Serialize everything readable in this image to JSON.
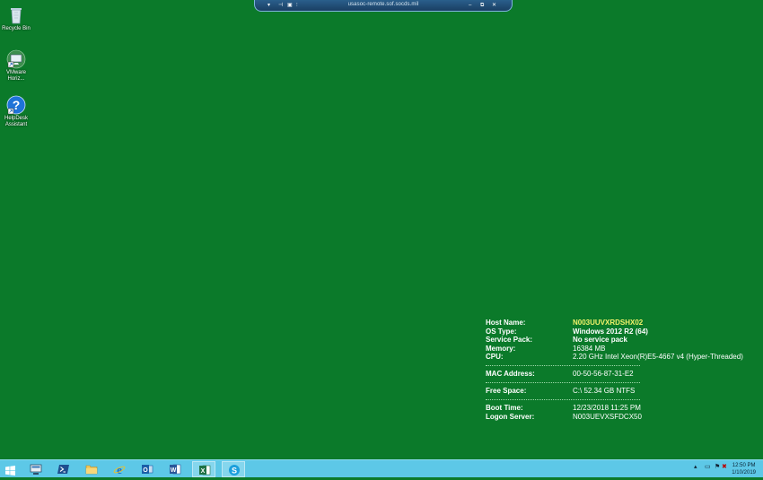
{
  "rdp_bar": {
    "title": "usasoc-remote.sof.socds.mil"
  },
  "desktop_icons": [
    {
      "label": "Recycle Bin",
      "icon": "recycle-bin-icon"
    },
    {
      "label": "VMware Horiz...",
      "icon": "vmware-horizon-icon"
    },
    {
      "label": "HelpDesk Assistant",
      "icon": "helpdesk-icon"
    }
  ],
  "bginfo": {
    "host_name_label": "Host Name:",
    "host_name": "N003UUVXRDSHX02",
    "os_type_label": "OS Type:",
    "os_type": "Windows 2012 R2 (64)",
    "service_pack_label": "Service Pack:",
    "service_pack": "No service pack",
    "memory_label": "Memory:",
    "memory": "16384 MB",
    "cpu_label": "CPU:",
    "cpu": "2.20 GHz Intel Xeon(R)E5-4667 v4 (Hyper-Threaded)",
    "mac_label": "MAC Address:",
    "mac": "00-50-56-87-31-E2",
    "free_space_label": "Free Space:",
    "free_space": "C:\\ 52.34 GB NTFS",
    "boot_time_label": "Boot Time:",
    "boot_time": "12/23/2018 11:25 PM",
    "logon_server_label": "Logon Server:",
    "logon_server": "N003UEVXSFDCX50"
  },
  "taskbar": {
    "apps": [
      {
        "name": "server-manager",
        "icon": "server-manager-icon"
      },
      {
        "name": "powershell",
        "icon": "powershell-icon"
      },
      {
        "name": "file-explorer",
        "icon": "folder-icon"
      },
      {
        "name": "internet-explorer",
        "icon": "ie-icon"
      },
      {
        "name": "outlook",
        "icon": "outlook-icon"
      },
      {
        "name": "word",
        "icon": "word-icon"
      },
      {
        "name": "excel",
        "icon": "excel-icon"
      },
      {
        "name": "skype",
        "icon": "skype-icon"
      }
    ],
    "clock_time": "12:50 PM",
    "clock_date": "1/10/2019"
  },
  "colors": {
    "desktop": "#0b7a2a",
    "taskbar": "#5dc8e7",
    "host_name": "#f1f26a"
  }
}
